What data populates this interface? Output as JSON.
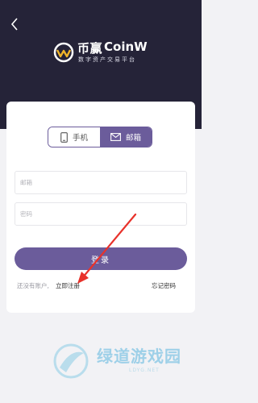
{
  "header": {
    "brand_cn": "币赢",
    "brand_en": "CoinW",
    "tagline": "数字资产交易平台"
  },
  "tabs": [
    {
      "label": "手机",
      "icon": "phone-icon",
      "active": false
    },
    {
      "label": "邮箱",
      "icon": "mail-icon",
      "active": true
    }
  ],
  "form": {
    "email_placeholder": "邮箱",
    "password_placeholder": "密码",
    "login_label": "登录"
  },
  "footer_links": {
    "no_account": "还没有账户,",
    "register": "立即注册",
    "forgot": "忘记密码"
  },
  "watermark": {
    "cn": "绿道游戏园",
    "en": "LDYG.NET"
  },
  "colors": {
    "header_bg": "#252338",
    "accent": "#6b5c9b",
    "arrow": "#e8322b"
  }
}
